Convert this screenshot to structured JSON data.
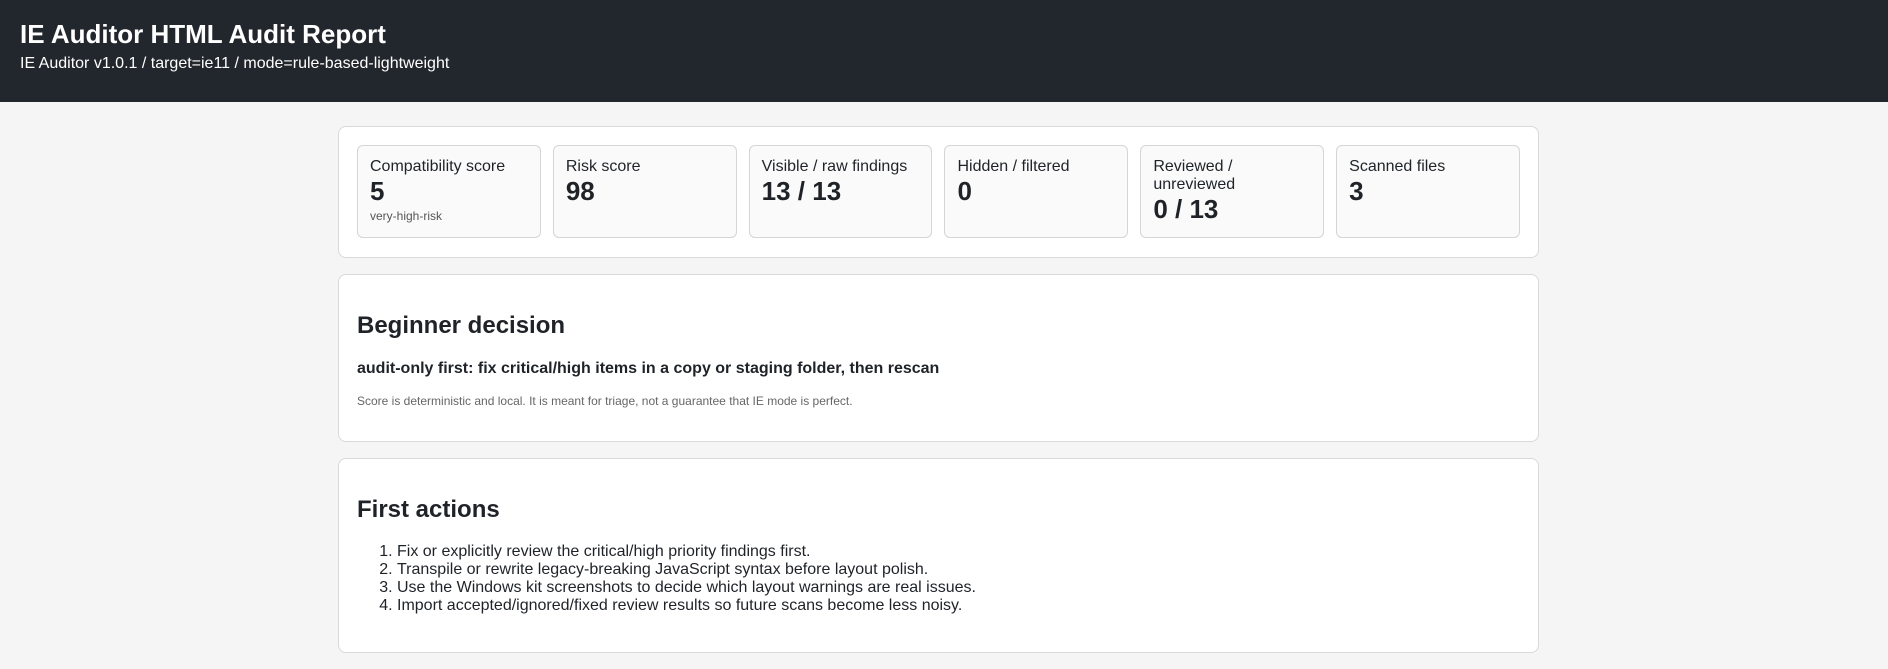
{
  "header": {
    "title": "IE Auditor HTML Audit Report",
    "subtitle": "IE Auditor v1.0.1 / target=ie11 / mode=rule-based-lightweight"
  },
  "metrics": [
    {
      "label": "Compatibility score",
      "value": "5",
      "note": "very-high-risk"
    },
    {
      "label": "Risk score",
      "value": "98",
      "note": ""
    },
    {
      "label": "Visible / raw findings",
      "value": "13 / 13",
      "note": ""
    },
    {
      "label": "Hidden / filtered",
      "value": "0",
      "note": ""
    },
    {
      "label": "Reviewed / unreviewed",
      "value": "0 / 13",
      "note": ""
    },
    {
      "label": "Scanned files",
      "value": "3",
      "note": ""
    }
  ],
  "decision": {
    "heading": "Beginner decision",
    "text": "audit-only first: fix critical/high items in a copy or staging folder, then rescan",
    "note": "Score is deterministic and local. It is meant for triage, not a guarantee that IE mode is perfect."
  },
  "actions": {
    "heading": "First actions",
    "items": [
      "Fix or explicitly review the critical/high priority findings first.",
      "Transpile or rewrite legacy-breaking JavaScript syntax before layout polish.",
      "Use the Windows kit screenshots to decide which layout warnings are real issues.",
      "Import accepted/ignored/fixed review results so future scans become less noisy."
    ]
  }
}
